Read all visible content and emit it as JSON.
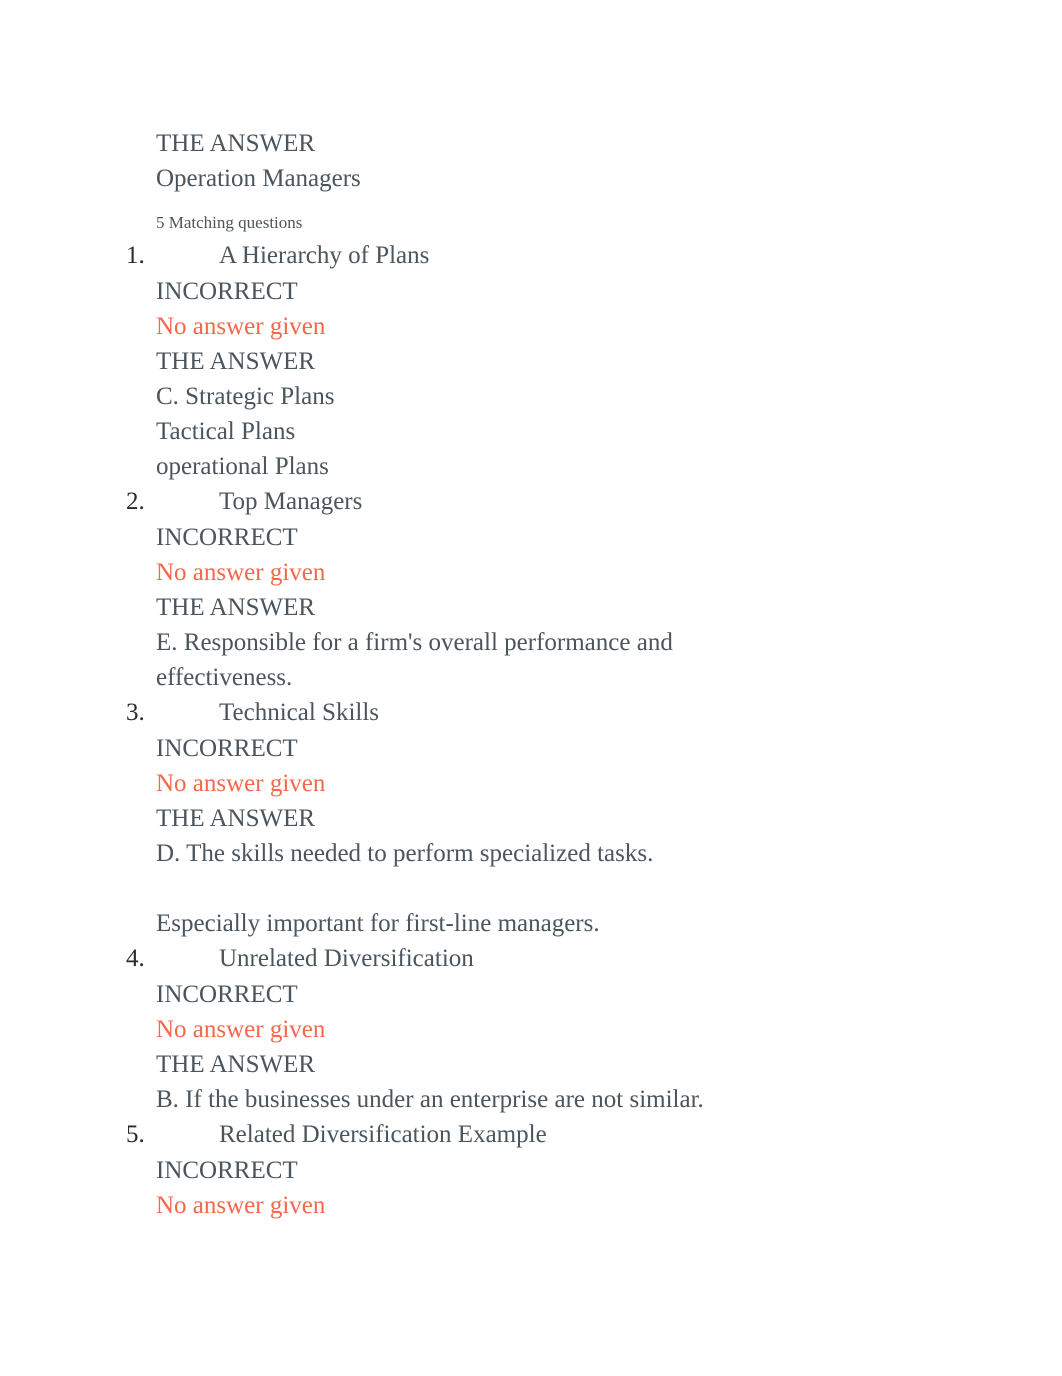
{
  "document": {
    "header": {
      "lines": [
        "THE ANSWER",
        "Operation Managers"
      ]
    },
    "meta": "5 Matching questions",
    "labels": {
      "incorrect": "INCORRECT",
      "no_answer": "No answer given",
      "the_answer": "THE ANSWER"
    },
    "colors": {
      "body_text": "#4a555e",
      "number_text": "#2a2a2a",
      "incorrect_answer": "#f4674a",
      "page_background": "#ffffff"
    },
    "questions": [
      {
        "number": "1.",
        "title": "A Hierarchy of Plans",
        "status": "INCORRECT",
        "user_answer": "No answer given",
        "answer_label": "THE ANSWER",
        "answer_lines": [
          "C. Strategic Plans",
          "Tactical Plans",
          "operational Plans"
        ]
      },
      {
        "number": "2.",
        "title": "Top Managers",
        "status": "INCORRECT",
        "user_answer": "No answer given",
        "answer_label": "THE ANSWER",
        "answer_lines": [
          "E. Responsible for a firm's overall performance and effectiveness."
        ]
      },
      {
        "number": "3.",
        "title": "Technical Skills",
        "status": "INCORRECT",
        "user_answer": "No answer given",
        "answer_label": "THE ANSWER",
        "answer_lines": [
          "D. The skills needed to perform specialized tasks.",
          " ",
          "Especially important for first-line managers."
        ]
      },
      {
        "number": "4.",
        "title": "Unrelated Diversification",
        "status": "INCORRECT",
        "user_answer": "No answer given",
        "answer_label": "THE ANSWER",
        "answer_lines": [
          "B. If the businesses under an enterprise are not similar."
        ]
      },
      {
        "number": "5.",
        "title": "Related Diversification Example",
        "status": "INCORRECT",
        "user_answer": "No answer given",
        "answer_label": "",
        "answer_lines": []
      }
    ]
  }
}
